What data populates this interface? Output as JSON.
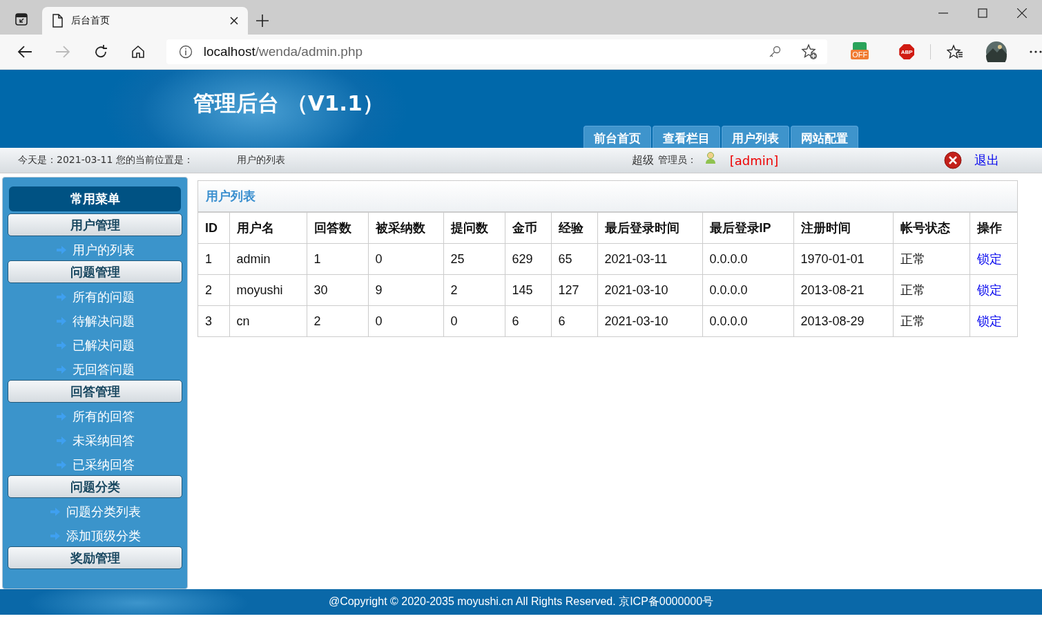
{
  "browser": {
    "tab_title": "后台首页",
    "address": {
      "host": "localhost",
      "path": "/wenda/admin.php"
    },
    "extensions": [
      {
        "label": "OFF"
      },
      {
        "label": "ABP"
      }
    ]
  },
  "header": {
    "title": "管理后台 （V1.1）",
    "nav": [
      {
        "label": "前台首页"
      },
      {
        "label": "查看栏目"
      },
      {
        "label": "用户列表"
      },
      {
        "label": "网站配置"
      }
    ]
  },
  "infobar": {
    "date_text": "今天是：2021-03-11 您的当前位置是：",
    "location": "用户的列表",
    "role": "超级",
    "role_label": "管理员：",
    "user": "[admin]",
    "logout": "退出"
  },
  "sidebar": {
    "title": "常用菜单",
    "groups": [
      {
        "title": "用户管理",
        "items": [
          "用户的列表"
        ]
      },
      {
        "title": "问题管理",
        "items": [
          "所有的问题",
          "待解决问题",
          "已解决问题",
          "无回答问题"
        ]
      },
      {
        "title": "回答管理",
        "items": [
          "所有的回答",
          "未采纳回答",
          "已采纳回答"
        ]
      },
      {
        "title": "问题分类",
        "items": [
          "问题分类列表",
          "添加顶级分类"
        ]
      },
      {
        "title": "奖励管理"
      }
    ]
  },
  "panel": {
    "title": "用户列表",
    "columns": [
      "ID",
      "用户名",
      "回答数",
      "被采纳数",
      "提问数",
      "金币",
      "经验",
      "最后登录时间",
      "最后登录IP",
      "注册时间",
      "帐号状态",
      "操作"
    ],
    "rows": [
      {
        "cells": [
          "1",
          "admin",
          "1",
          "0",
          "25",
          "629",
          "65",
          "2021-03-11",
          "0.0.0.0",
          "1970-01-01",
          "正常"
        ],
        "action": "锁定"
      },
      {
        "cells": [
          "2",
          "moyushi",
          "30",
          "9",
          "2",
          "145",
          "127",
          "2021-03-10",
          "0.0.0.0",
          "2013-08-21",
          "正常"
        ],
        "action": "锁定"
      },
      {
        "cells": [
          "3",
          "cn",
          "2",
          "0",
          "0",
          "6",
          "6",
          "2021-03-10",
          "0.0.0.0",
          "2013-08-29",
          "正常"
        ],
        "action": "锁定"
      }
    ]
  },
  "footer": {
    "text": "@Copyright © 2020-2035 moyushi.cn All Rights Reserved. 京ICP备0000000号"
  }
}
